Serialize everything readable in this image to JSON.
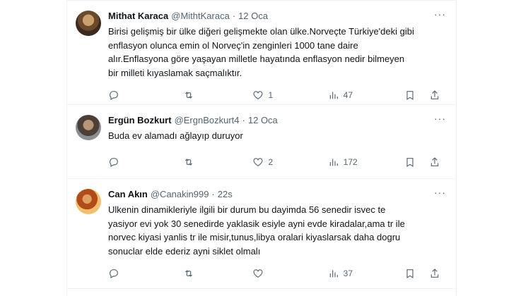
{
  "tweets": [
    {
      "name": "Mithat Karaca",
      "handle": "@MithtKaraca",
      "separator": "·",
      "time": "12 Oca",
      "more": "···",
      "text": "Birisi gelişmiş bir ülke diğeri gelişmekte olan ülke.Norveçte Türkiye'deki gibi\nenflasyon olunca emin ol Norveç'in zenginleri 1000 tane daire\nalır.Enflasyona göre yaşayan milletle hayatında enflasyon nedir bilmeyen\nbir milleti kıyaslamak saçmalıktır.",
      "replies": "",
      "retweets": "",
      "likes": "1",
      "views": "47"
    },
    {
      "name": "Ergün Bozkurt",
      "handle": "@ErgnBozkurt4",
      "separator": "·",
      "time": "12 Oca",
      "more": "···",
      "text": "Buda ev alamadı ağlayıp duruyor",
      "replies": "",
      "retweets": "",
      "likes": "2",
      "views": "172"
    },
    {
      "name": "Can Akın",
      "handle": "@Canakin999",
      "separator": "·",
      "time": "22s",
      "more": "···",
      "text": "Ulkenin dinamikleriyle ilgili bir durum bu dayimda 56 senedir isvec te\nyasiyor evi yok 30 senedirde yaklasik esiyle ayni evde kiradalar,ama tr ile\nnorvec kiyasi yanlis tr ile misir,tunus,libya oralari kiyaslarsak daha dogru\nsonuclar elde ederiz ayni siklet olmalı",
      "replies": "",
      "retweets": "",
      "likes": "",
      "views": "37"
    }
  ],
  "icons": [
    "reply-icon",
    "retweet-icon",
    "like-icon",
    "views-icon",
    "bookmark-icon",
    "share-icon",
    "more-icon"
  ],
  "colors": {
    "text": "#0f1419",
    "secondary": "#536471",
    "border": "#eff3f4"
  }
}
